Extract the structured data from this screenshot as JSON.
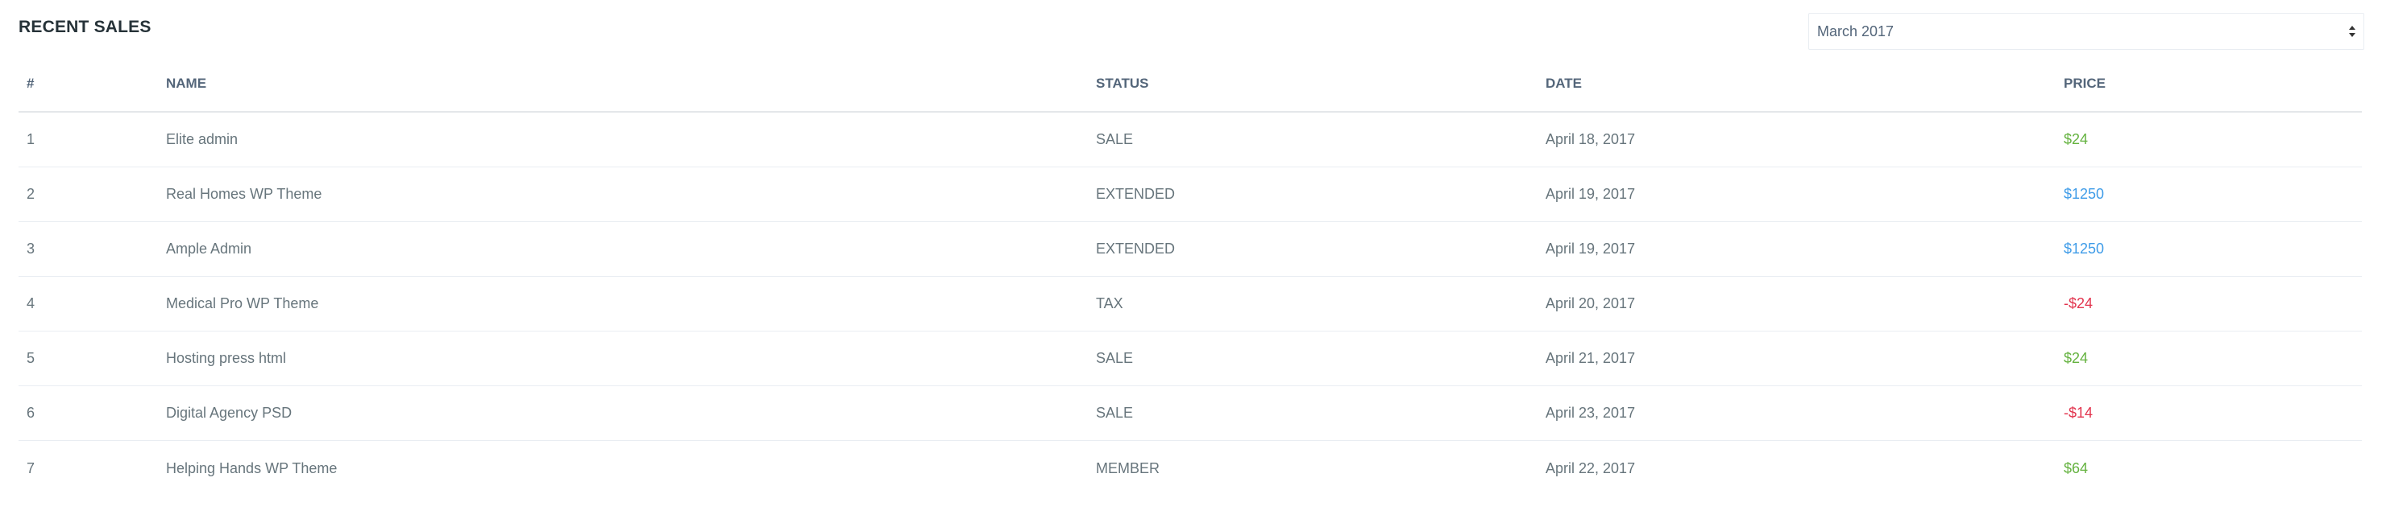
{
  "widget": {
    "title": "RECENT SALES",
    "month_select": {
      "selected": "March 2017"
    }
  },
  "table": {
    "headers": {
      "num": "#",
      "name": "NAME",
      "status": "STATUS",
      "date": "DATE",
      "price": "PRICE"
    },
    "rows": [
      {
        "num": "1",
        "name": "Elite admin",
        "status": "SALE",
        "date": "April 18, 2017",
        "price": "$24",
        "price_color": "green"
      },
      {
        "num": "2",
        "name": "Real Homes WP Theme",
        "status": "EXTENDED",
        "date": "April 19, 2017",
        "price": "$1250",
        "price_color": "blue"
      },
      {
        "num": "3",
        "name": "Ample Admin",
        "status": "EXTENDED",
        "date": "April 19, 2017",
        "price": "$1250",
        "price_color": "blue"
      },
      {
        "num": "4",
        "name": "Medical Pro WP Theme",
        "status": "TAX",
        "date": "April 20, 2017",
        "price": "-$24",
        "price_color": "red"
      },
      {
        "num": "5",
        "name": "Hosting press html",
        "status": "SALE",
        "date": "April 21, 2017",
        "price": "$24",
        "price_color": "green"
      },
      {
        "num": "6",
        "name": "Digital Agency PSD",
        "status": "SALE",
        "date": "April 23, 2017",
        "price": "-$14",
        "price_color": "red"
      },
      {
        "num": "7",
        "name": "Helping Hands WP Theme",
        "status": "MEMBER",
        "date": "April 22, 2017",
        "price": "$64",
        "price_color": "green"
      }
    ]
  },
  "colors": {
    "green": "#64b23f",
    "blue": "#3f9ce8",
    "red": "#e2344e",
    "text": "#67757c",
    "heading": "#263238",
    "border": "#e9edf2"
  },
  "icons": {
    "select_arrows": "chevron-up-down-icon"
  }
}
